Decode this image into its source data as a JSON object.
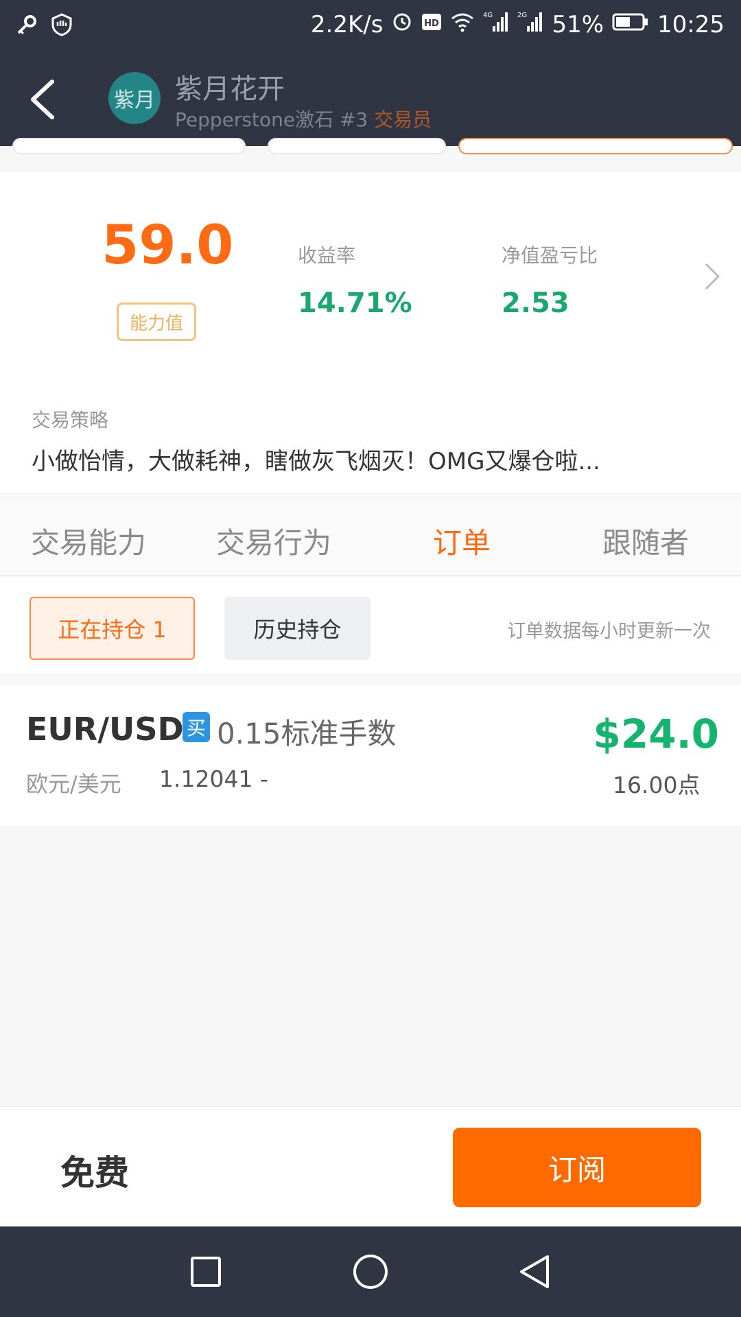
{
  "status_bar": {
    "speed": "2.2K/s",
    "battery": "51%",
    "time": "10:25",
    "icons": [
      "key-icon",
      "shield-icon",
      "alarm-icon",
      "hd-icon",
      "wifi-icon",
      "4g-signal-icon",
      "2g-signal-icon",
      "battery-icon"
    ]
  },
  "header": {
    "back_icon": "back-arrow-icon",
    "avatar_text": "紫月",
    "name": "紫月花开",
    "broker": "Pepperstone激石 #3",
    "role": "交易员"
  },
  "stats": {
    "score": "59.0",
    "score_label": "能力值",
    "return_label": "收益率",
    "return_value": "14.71%",
    "ratio_label": "净值盈亏比",
    "ratio_value": "2.53"
  },
  "strategy": {
    "title": "交易策略",
    "text": "小做怡情，大做耗神，瞎做灰飞烟灭！OMG又爆仓啦..."
  },
  "tabs": [
    {
      "label": "交易能力",
      "active": false
    },
    {
      "label": "交易行为",
      "active": false
    },
    {
      "label": "订单",
      "active": true
    },
    {
      "label": "跟随者",
      "active": false
    }
  ],
  "filter": {
    "open_label": "正在持仓 1",
    "history_label": "历史持仓",
    "note": "订单数据每小时更新一次"
  },
  "order": {
    "pair": "EUR/USD",
    "side": "买",
    "lots": "0.15标准手数",
    "pair_cn": "欧元/美元",
    "price": "1.12041 -",
    "profit": "$24.0",
    "points": "16.00点"
  },
  "actions": {
    "price_label": "免费",
    "subscribe_label": "订阅"
  },
  "colors": {
    "accent": "#ff6a14",
    "positive": "#1aa86e",
    "header_bg": "#2f3542",
    "buy": "#2b95e0"
  }
}
